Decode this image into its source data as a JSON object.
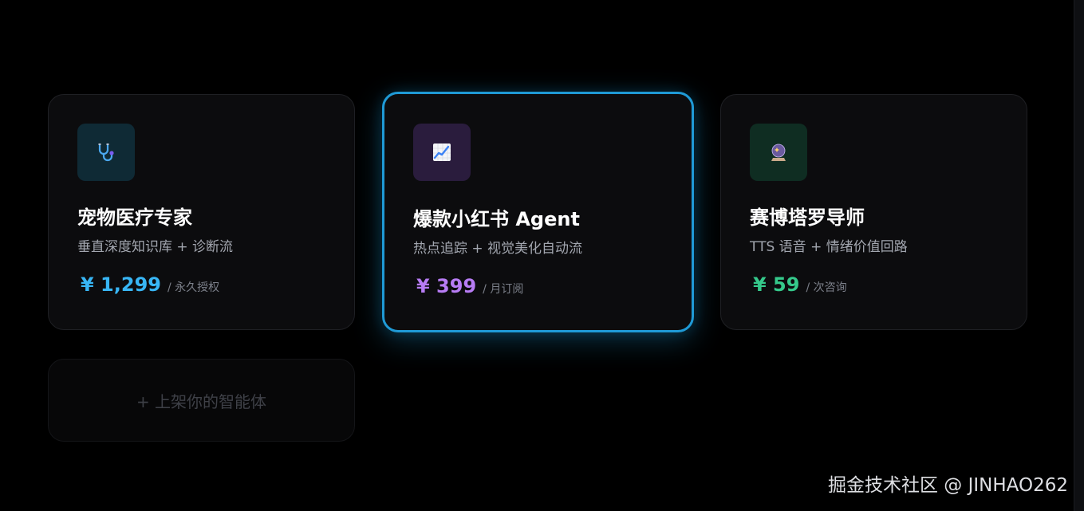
{
  "cards": [
    {
      "icon": "stethoscope-icon",
      "icon_bg": "#0f2a35",
      "title": "宠物医疗专家",
      "desc": "垂直深度知识库 + 诊断流",
      "price": "¥ 1,299",
      "price_color": "#38b6f5",
      "unit": "/ 永久授权",
      "featured": false
    },
    {
      "icon": "chart-increasing-icon",
      "icon_bg": "#2a1c3d",
      "title": "爆款小红书 Agent",
      "desc": "热点追踪 + 视觉美化自动流",
      "price": "¥ 399",
      "price_color": "#b77cf4",
      "unit": "/ 月订阅",
      "featured": true,
      "accent": "#1f9ad6"
    },
    {
      "icon": "crystal-ball-icon",
      "icon_bg": "#0f2d22",
      "title": "赛博塔罗导师",
      "desc": "TTS 语音 + 情绪价值回路",
      "price": "¥ 59",
      "price_color": "#35c98b",
      "unit": "/ 次咨询",
      "featured": false
    }
  ],
  "add_card": {
    "label": "+ 上架你的智能体"
  },
  "watermark": "掘金技术社区 @ JINHAO262"
}
